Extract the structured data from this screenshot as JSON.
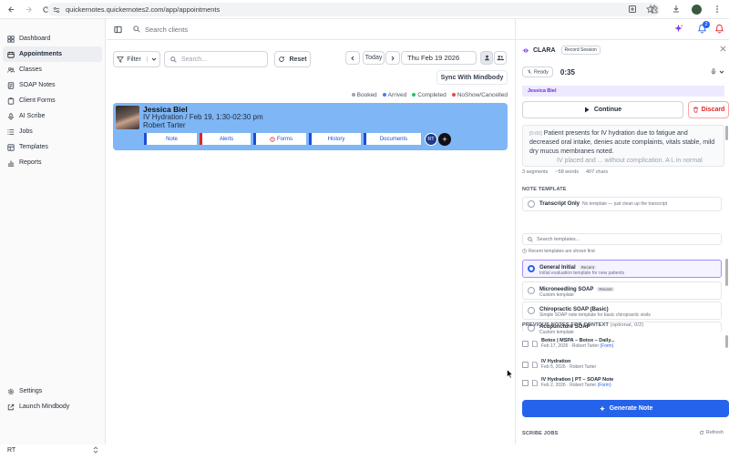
{
  "browser": {
    "url": "quickernotes.quickernotes2.com/app/appointments",
    "notification_count": "2"
  },
  "sidebar": {
    "items": [
      {
        "label": "Dashboard",
        "icon": "grid-icon"
      },
      {
        "label": "Appointments",
        "icon": "calendar-icon",
        "active": true
      },
      {
        "label": "Classes",
        "icon": "users-icon"
      },
      {
        "label": "SOAP Notes",
        "icon": "note-icon"
      },
      {
        "label": "Client Forms",
        "icon": "clipboard-icon"
      },
      {
        "label": "AI Scribe",
        "icon": "mic-icon"
      },
      {
        "label": "Jobs",
        "icon": "list-icon"
      },
      {
        "label": "Templates",
        "icon": "template-icon"
      },
      {
        "label": "Reports",
        "icon": "chart-icon"
      }
    ],
    "bottom": [
      {
        "label": "Settings",
        "icon": "gear-icon"
      },
      {
        "label": "Launch Mindbody",
        "icon": "external-icon"
      }
    ],
    "user_initials": "RT"
  },
  "header": {
    "search_placeholder": "Search clients"
  },
  "toolbar": {
    "filter_label": "Filter",
    "search_placeholder": "Search...",
    "reset_label": "Reset",
    "today_label": "Today",
    "date_value": "Thu Feb 19 2026",
    "sync_label": "Sync With Mindbody"
  },
  "legend": [
    {
      "label": "Booked",
      "color": "#9ca3af"
    },
    {
      "label": "Arrived",
      "color": "#3b82f6"
    },
    {
      "label": "Completed",
      "color": "#22c55e"
    },
    {
      "label": "NoShow/Cancelled",
      "color": "#ef4444"
    }
  ],
  "appointment": {
    "client_name": "Jessica Biel",
    "service": "IV Hydration / Feb 19, 1:30-02:30 pm",
    "provider": "Robert Tarter",
    "tabs": [
      {
        "label": "Note",
        "color": "#1d4ed8"
      },
      {
        "label": "Alerts",
        "color": "#dc2626"
      },
      {
        "label": "Forms",
        "color": "#1d4ed8"
      },
      {
        "label": "History",
        "color": "#1d4ed8"
      },
      {
        "label": "Documents",
        "color": "#1d4ed8"
      }
    ],
    "initials": "RT",
    "add_label": "+",
    "color": "#7fb6f6"
  },
  "scribe": {
    "brand": "CLARA",
    "mode_label": "Record Session",
    "status": "Ready",
    "timer": "0:35",
    "client_name": "Jessica Biel",
    "continue_label": "Continue",
    "discard_label": "Discard",
    "transcript_timestamp": "[0:00]",
    "transcript_text": "Patient presents for IV hydration due to fatigue and decreased oral intake, denies acute complaints, vitals stable, mild dry mucus membranes noted.",
    "transcript_more": "IV placed and ... without complication. A L in normal",
    "stats": {
      "segments": "3 segments",
      "words": "~58 words",
      "chars": "407 chars"
    },
    "note_template_label": "NOTE TEMPLATE",
    "transcript_only": {
      "name": "Transcript Only",
      "desc": "No template — just clean up the transcript"
    },
    "template_search_placeholder": "Search templates...",
    "recent_info": "Recent templates are shown first",
    "templates": [
      {
        "name": "General Initial",
        "badge": "Recent",
        "desc": "Initial evaluation template for new patients",
        "selected": true
      },
      {
        "name": "Microneedling SOAP",
        "badge": "Recent",
        "desc": "Custom template",
        "selected": false
      },
      {
        "name": "Chiropractic SOAP (Basic)",
        "badge": "",
        "desc": "Simple SOAP note template for basic chiropractic visits",
        "selected": false
      },
      {
        "name": "Acupuncture SOAP",
        "badge": "",
        "desc": "Custom template",
        "selected": false
      }
    ],
    "previous_label": "PREVIOUS NOTES FOR CONTEXT",
    "previous_hint": "(optional, 0/2)",
    "previous_notes": [
      {
        "title": "Botox | MSPA – Botox – Daily...",
        "date": "Feb 17, 2026 · Robert Tarter",
        "tag": "(Form)"
      },
      {
        "title": "IV Hydration",
        "date": "Feb 5, 2026 · Robert Tarter",
        "tag": ""
      },
      {
        "title": "IV Hydration | PT – SOAP Note",
        "date": "Feb 2, 2026 · Robert Tarter",
        "tag": "(Form)"
      }
    ],
    "generate_label": "Generate Note",
    "jobs_label": "SCRIBE JOBS",
    "refresh_label": "Refresh"
  }
}
